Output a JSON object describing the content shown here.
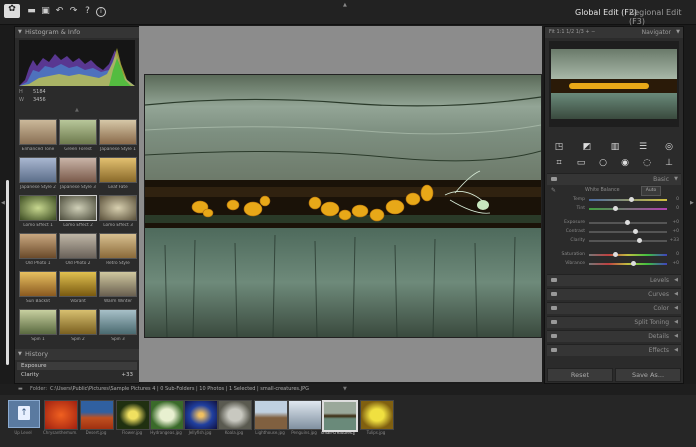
{
  "toolbar": {
    "icons": [
      "app-logo",
      "open-folder",
      "save",
      "undo",
      "redo",
      "help",
      "info"
    ],
    "tabs": [
      {
        "label": "Global Edit (F2)",
        "active": true
      },
      {
        "label": "Regional Edit (F3)",
        "active": false
      }
    ]
  },
  "left_panel": {
    "histogram_title": "Histogram & Info",
    "info": {
      "h_label": "H",
      "h_value": "5184",
      "w_label": "W",
      "w_value": "3456"
    },
    "presets": [
      "Enhanced Tone",
      "Green Forest",
      "Japanese Style 1",
      "Japanese Style 2",
      "Japanese Style 3",
      "Leaf Fate",
      "Lomo Effect 1",
      "Lomo Effect 2",
      "Lomo Effect 3",
      "Old Photo 1",
      "Old Photo 2",
      "Retro Style",
      "Sun Backlit",
      "Vibrant",
      "Warm Winter",
      "Spin 1",
      "Spin 2",
      "Spin 3"
    ],
    "history_title": "History",
    "history_items": [
      {
        "label": "Exposure",
        "value": ""
      },
      {
        "label": "Clarity",
        "value": "+33"
      }
    ]
  },
  "right_panel": {
    "zoom_options": "Fit 1:1 1/2 1/3 + −",
    "navigator_title": "Navigator",
    "basic_title": "Basic",
    "white_balance_label": "White Balance",
    "white_balance_button": "Auto",
    "sliders": [
      {
        "label": "Temp",
        "value": "0"
      },
      {
        "label": "Tint",
        "value": "0"
      },
      {
        "label": "Exposure",
        "value": "+0"
      },
      {
        "label": "Contrast",
        "value": "+0"
      },
      {
        "label": "Clarity",
        "value": "+33"
      },
      {
        "label": "Saturation",
        "value": "0"
      },
      {
        "label": "Vibrance",
        "value": "+0"
      }
    ],
    "sections": [
      "Levels",
      "Curves",
      "Color",
      "Split Toning",
      "Details",
      "Effects"
    ],
    "reset_label": "Reset",
    "save_as_label": "Save As..."
  },
  "folder_bar": {
    "label": "Folder:",
    "path": "C:\\Users\\Public\\Pictures\\Sample Pictures 4 | 0 Sub-Folders | 10 Photos | 1 Selected | small-creatures.JPG"
  },
  "filmstrip": {
    "up_label": "Up Level",
    "items": [
      "Chrysanthemum.jpg",
      "Desert.jpg",
      "Flower.jpg",
      "Hydrangeas.jpg",
      "Jellyfish.jpg",
      "Koala.jpg",
      "Lighthouse.jpg",
      "Penguins.jpg",
      "small-creatures.jpg",
      "Tulips.jpg"
    ],
    "selected_index": 8
  },
  "colors": {
    "accent": "#e6e6e6",
    "panel": "#2b2b2b",
    "canvas": "#8c8c8c"
  }
}
